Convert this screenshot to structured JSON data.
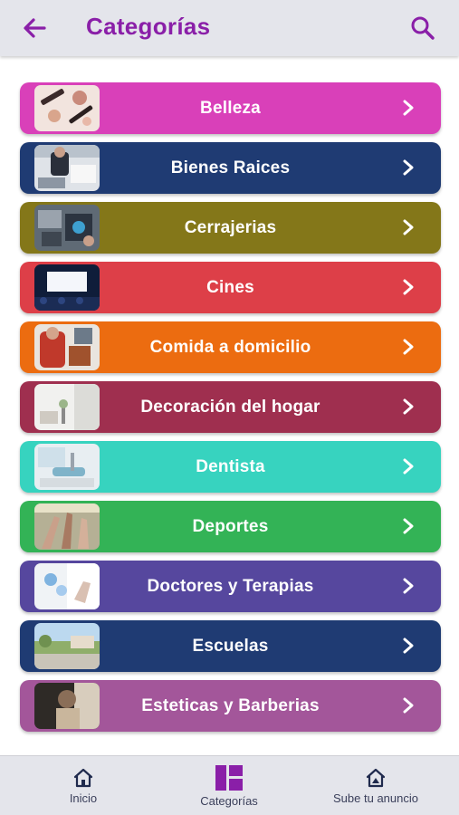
{
  "appbar": {
    "title": "Categorías",
    "back_icon": "arrow-left-icon",
    "search_icon": "search-icon",
    "accent_color": "#8a1fa8"
  },
  "categories": [
    {
      "label": "Belleza",
      "color": "#d940b9",
      "thumb": "makeup-photo"
    },
    {
      "label": "Bienes Raices",
      "color": "#1f3b73",
      "thumb": "office-photo"
    },
    {
      "label": "Cerrajerias",
      "color": "#847719",
      "thumb": "locksmith-photo"
    },
    {
      "label": "Cines",
      "color": "#dd3f48",
      "thumb": "cinema-photo"
    },
    {
      "label": "Comida a domicilio",
      "color": "#ec6c10",
      "thumb": "delivery-photo"
    },
    {
      "label": "Decoración del hogar",
      "color": "#9f2f4f",
      "thumb": "interior-photo"
    },
    {
      "label": "Dentista",
      "color": "#37d3bf",
      "thumb": "dental-photo"
    },
    {
      "label": "Deportes",
      "color": "#33b356",
      "thumb": "sports-photo"
    },
    {
      "label": "Doctores y Terapias",
      "color": "#56479e",
      "thumb": "doctor-photo"
    },
    {
      "label": "Escuelas",
      "color": "#1f3b73",
      "thumb": "school-photo"
    },
    {
      "label": "Esteticas y Barberias",
      "color": "#a3569a",
      "thumb": "barber-photo"
    }
  ],
  "bottom_nav": [
    {
      "label": "Inicio",
      "icon": "home-icon",
      "active": false
    },
    {
      "label": "Categorías",
      "icon": "grid-icon",
      "active": true
    },
    {
      "label": "Sube tu anuncio",
      "icon": "house-upload-icon",
      "active": false
    }
  ]
}
